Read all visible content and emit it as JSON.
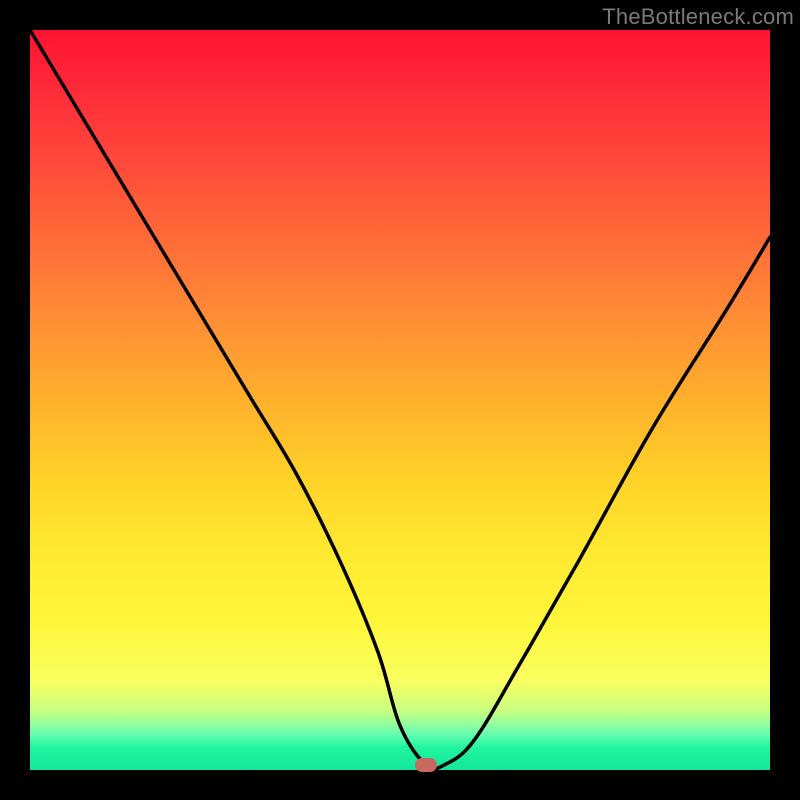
{
  "watermark": "TheBottleneck.com",
  "marker": {
    "x_pct": 53.5,
    "y_pct": 99.3,
    "color": "#c76a5e"
  },
  "chart_data": {
    "type": "line",
    "title": "",
    "xlabel": "",
    "ylabel": "",
    "xlim": [
      0,
      100
    ],
    "ylim": [
      0,
      100
    ],
    "grid": false,
    "legend": false,
    "annotations": [
      {
        "text": "TheBottleneck.com",
        "position": "top-right"
      }
    ],
    "marker_point": {
      "x": 53.5,
      "y": 0.7
    },
    "series": [
      {
        "name": "curve",
        "x": [
          0,
          6,
          12,
          18,
          24,
          30,
          36,
          42,
          47,
          50,
          53.5,
          56,
          60,
          66,
          74,
          84,
          94,
          100
        ],
        "values": [
          100,
          90,
          80,
          70,
          60,
          50,
          40,
          28,
          16,
          6,
          0.7,
          0.7,
          4,
          14,
          28,
          46,
          62,
          72
        ]
      }
    ],
    "background_gradient": {
      "direction": "vertical",
      "stops": [
        {
          "pct": 0,
          "color": "#ff1430"
        },
        {
          "pct": 50,
          "color": "#ffb02c"
        },
        {
          "pct": 80,
          "color": "#fff63a"
        },
        {
          "pct": 95,
          "color": "#6cffb0"
        },
        {
          "pct": 100,
          "color": "#14e59b"
        }
      ]
    }
  }
}
